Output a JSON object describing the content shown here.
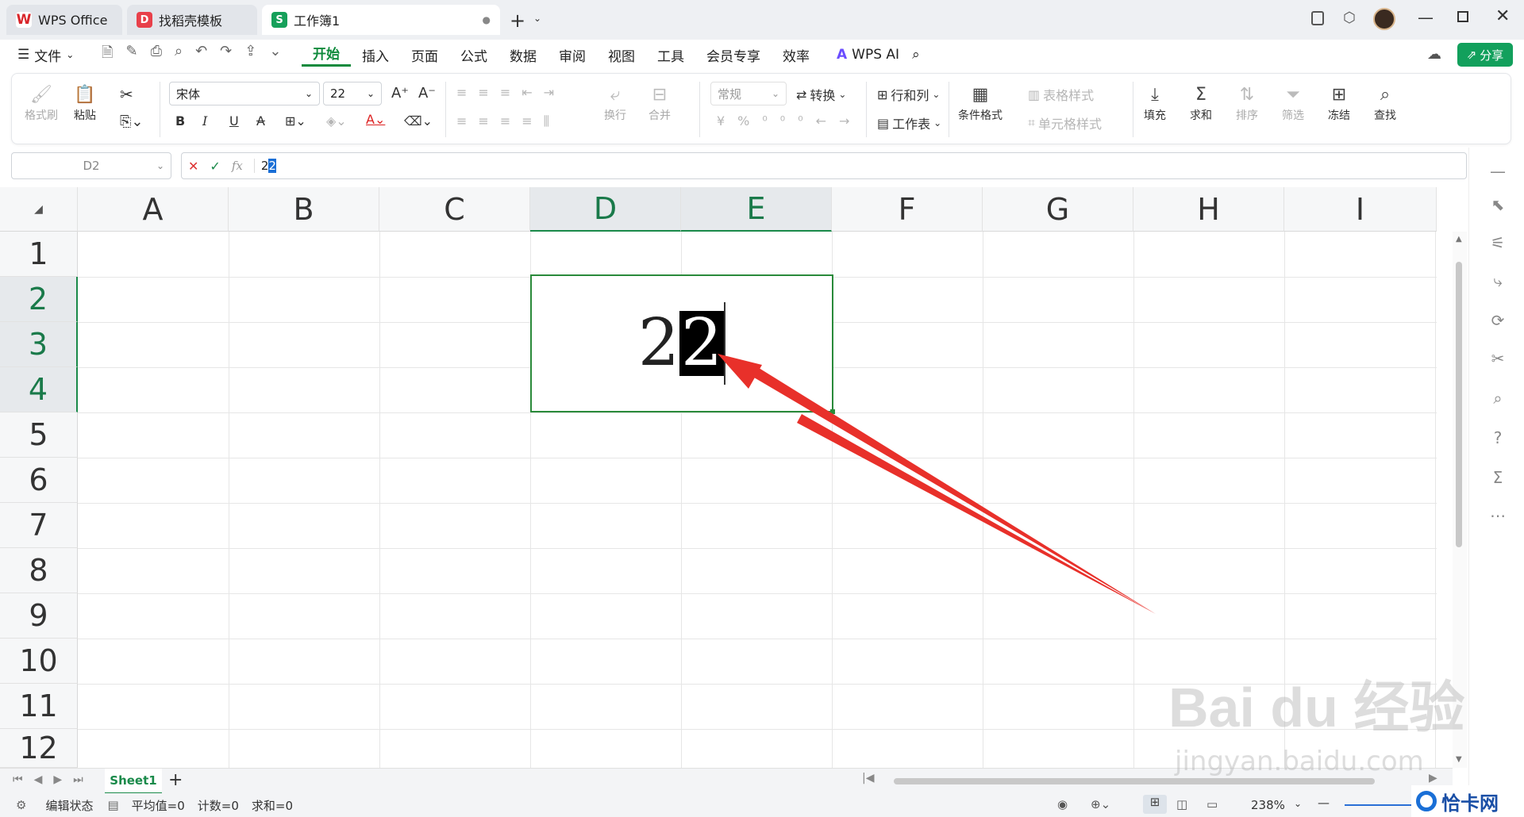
{
  "tabs": [
    {
      "label": "WPS Office",
      "icon": "W"
    },
    {
      "label": "找稻壳模板",
      "icon": "D"
    },
    {
      "label": "工作簿1",
      "icon": "S"
    }
  ],
  "menu": {
    "file": "文件",
    "items": [
      "开始",
      "插入",
      "页面",
      "公式",
      "数据",
      "审阅",
      "视图",
      "工具",
      "会员专享",
      "效率"
    ],
    "ai": "WPS AI",
    "share": "分享"
  },
  "ribbon": {
    "format_painter": "格式刷",
    "paste": "粘贴",
    "font_name": "宋体",
    "font_size": "22",
    "wrap": "换行",
    "merge": "合并",
    "number_format": "常规",
    "convert": "转换",
    "rows_cols": "行和列",
    "worksheet": "工作表",
    "cond_format": "条件格式",
    "table_style": "表格样式",
    "cell_style": "单元格样式",
    "fill": "填充",
    "sum": "求和",
    "sort": "排序",
    "filter": "筛选",
    "freeze": "冻结",
    "find": "查找"
  },
  "formula": {
    "cell_ref": "D2",
    "content_plain": "2",
    "content_selected": "2",
    "fx": "fx"
  },
  "columns": [
    "A",
    "B",
    "C",
    "D",
    "E",
    "F",
    "G",
    "H",
    "I"
  ],
  "rows": [
    "1",
    "2",
    "3",
    "4",
    "5",
    "6",
    "7",
    "8",
    "9",
    "10",
    "11",
    "12"
  ],
  "cell": {
    "plain": "2",
    "selected": "2"
  },
  "sheet": {
    "name": "Sheet1"
  },
  "status": {
    "mode": "编辑状态",
    "avg": "平均值=0",
    "count": "计数=0",
    "sum": "求和=0",
    "zoom": "238%"
  },
  "watermark": {
    "brand": "Bai du 经验",
    "url": "jingyan.baidu.com",
    "badge": "恰卡网"
  },
  "colors": {
    "accent": "#0f8a3c",
    "selection": "#1a8a4a",
    "arrow": "#e8302a"
  }
}
